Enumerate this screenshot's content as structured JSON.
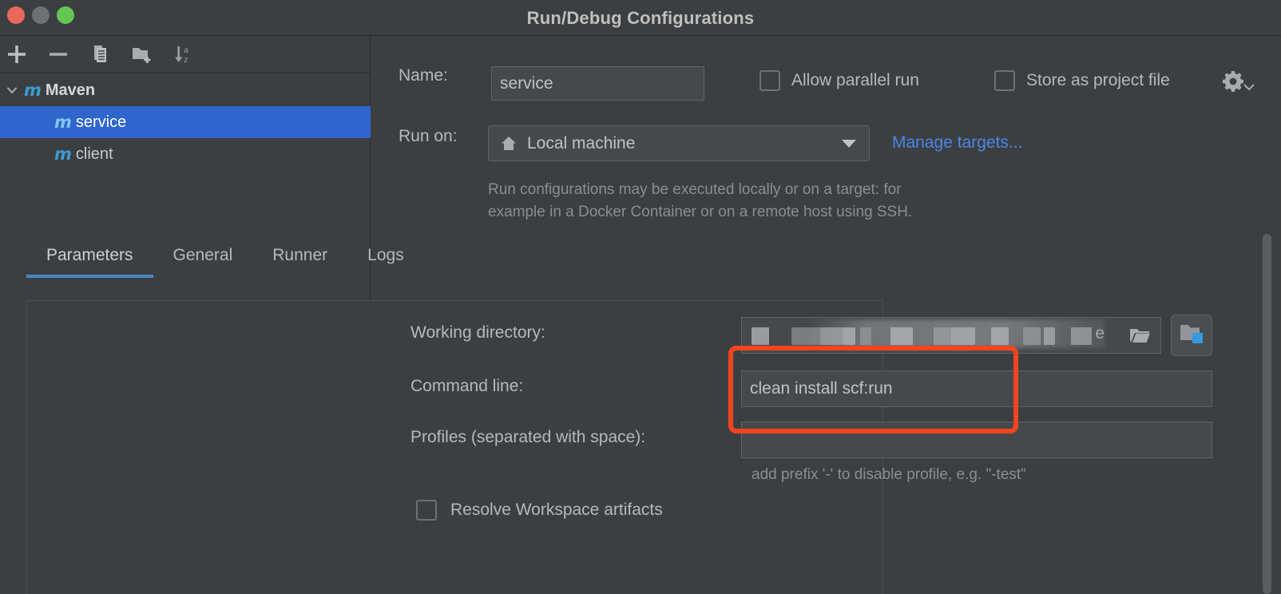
{
  "window": {
    "title": "Run/Debug Configurations",
    "traffic_lights": [
      "close-button",
      "minimize-button",
      "maximize-button"
    ],
    "colors": {
      "close": "#E8685A",
      "minimize": "#6E7173",
      "maximize": "#62C554",
      "background": "#3C3F41",
      "field_background": "#45494A",
      "selection_blue": "#2F65CC",
      "link_blue": "#4A87E8",
      "tab_underline": "#4A88C7",
      "annotation_red": "#F4451E",
      "maven_icon_blue": "#3C9CD4",
      "accent_cyan": "#359AE0"
    }
  },
  "left_panel": {
    "toolbar": [
      {
        "name": "add-configuration-button",
        "icon": "plus-icon",
        "label": "Add New Configuration"
      },
      {
        "name": "remove-configuration-button",
        "icon": "minus-icon",
        "label": "Remove Configuration"
      },
      {
        "name": "copy-configuration-button",
        "icon": "copy-icon",
        "label": "Copy Configuration"
      },
      {
        "name": "move-into-folder-button",
        "icon": "folder-add-icon",
        "label": "Create New Folder"
      },
      {
        "name": "sort-configurations-button",
        "icon": "sort-alphabetical-icon",
        "label": "Sort Configurations"
      }
    ],
    "tree": [
      {
        "label": "Maven",
        "icon": "maven-m-icon",
        "level": 0,
        "expanded": true,
        "selected": false,
        "chevron": "chevron-down-icon"
      },
      {
        "label": "service",
        "icon": "maven-m-icon",
        "level": 1,
        "expanded": false,
        "selected": true,
        "chevron": ""
      },
      {
        "label": "client",
        "icon": "maven-m-icon",
        "level": 1,
        "expanded": false,
        "selected": false,
        "chevron": ""
      }
    ]
  },
  "form": {
    "name_label": "Name:",
    "name_value": "service",
    "allow_parallel_run": {
      "label": "Allow parallel run",
      "checked": false
    },
    "store_as_project_file": {
      "label": "Store as project file",
      "checked": false
    },
    "gear_icon": "gear-dropdown-icon",
    "run_on_label": "Run on:",
    "run_on_value": "Local machine",
    "run_on_icon": "home-icon",
    "manage_targets_link": "Manage targets...",
    "description_line1": "Run configurations may be executed locally or on a target: for",
    "description_line2": "example in a Docker Container or on a remote host using SSH."
  },
  "tabs": [
    {
      "label": "Parameters",
      "active": true
    },
    {
      "label": "General",
      "active": false
    },
    {
      "label": "Runner",
      "active": false
    },
    {
      "label": "Logs",
      "active": false
    }
  ],
  "parameters": {
    "working_directory": {
      "label": "Working directory:",
      "value": "",
      "redacted": true,
      "visible_suffix": "e",
      "browse_icon": "folder-open-icon",
      "macro_button_icon": "folder-macro-icon"
    },
    "command_line": {
      "label": "Command line:",
      "value": "clean install scf:run",
      "highlighted": true
    },
    "profiles": {
      "label": "Profiles (separated with space):",
      "value": "",
      "hint": "add prefix '-' to disable profile, e.g. \"-test\""
    },
    "resolve_workspace_artifacts": {
      "label": "Resolve Workspace artifacts",
      "checked": false
    }
  },
  "scrollbar": {
    "name": "vertical-scrollbar",
    "orientation": "vertical"
  }
}
